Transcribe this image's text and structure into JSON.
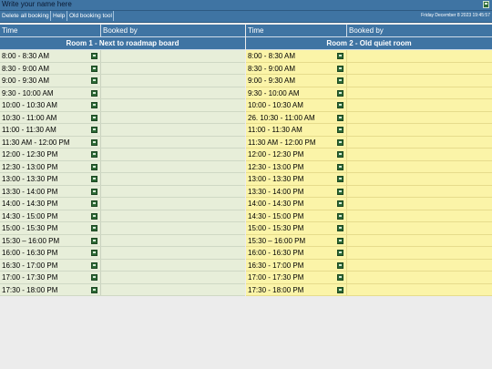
{
  "header": {
    "name_placeholder": "Write your name here",
    "save_icon": "save-icon"
  },
  "toolbar": {
    "delete_all": "Delete all booking",
    "help": "Help",
    "old_tool": "Old booking tool",
    "datetime": "Friday December 8 2023 19:45:57"
  },
  "columns": {
    "time": "Time",
    "booked_by": "Booked by"
  },
  "rooms": [
    {
      "title": "Room 1 - Next to roadmap board",
      "slots": [
        "8:00 - 8:30 AM",
        "8:30 - 9:00 AM",
        "9:00 - 9:30 AM",
        "9:30 - 10:00 AM",
        "10:00 - 10:30 AM",
        "10:30 - 11:00 AM",
        "11:00 - 11:30 AM",
        "11:30 AM - 12:00 PM",
        "12:00 - 12:30 PM",
        "12:30 - 13:00 PM",
        "13:00 - 13:30 PM",
        "13:30 - 14:00 PM",
        "14:00 - 14:30 PM",
        "14:30 - 15:00 PM",
        "15:00 - 15:30 PM",
        "15:30 – 16:00 PM",
        "16:00 - 16:30 PM",
        "16:30 - 17:00 PM",
        "17:00 - 17:30 PM",
        "17:30 - 18:00 PM"
      ],
      "color": "#e7eed9"
    },
    {
      "title": "Room 2 - Old quiet room",
      "slots": [
        "8:00 - 8:30 AM",
        "8:30 - 9:00 AM",
        "9:00 - 9:30 AM",
        "9:30 - 10:00 AM",
        "10:00 - 10:30 AM",
        "26. 10:30 - 11:00 AM",
        "11:00 - 11:30 AM",
        "11:30 AM - 12:00 PM",
        "12:00 - 12:30 PM",
        "12:30 - 13:00 PM",
        "13:00 - 13:30 PM",
        "13:30 - 14:00 PM",
        "14:00 - 14:30 PM",
        "14:30 - 15:00 PM",
        "15:00 - 15:30 PM",
        "15:30 – 16:00 PM",
        "16:00 - 16:30 PM",
        "16:30 - 17:00 PM",
        "17:00 - 17:30 PM",
        "17:30 - 18:00 PM"
      ],
      "color": "#fbf4a8"
    }
  ],
  "colors": {
    "accent": "#3f74a3"
  }
}
